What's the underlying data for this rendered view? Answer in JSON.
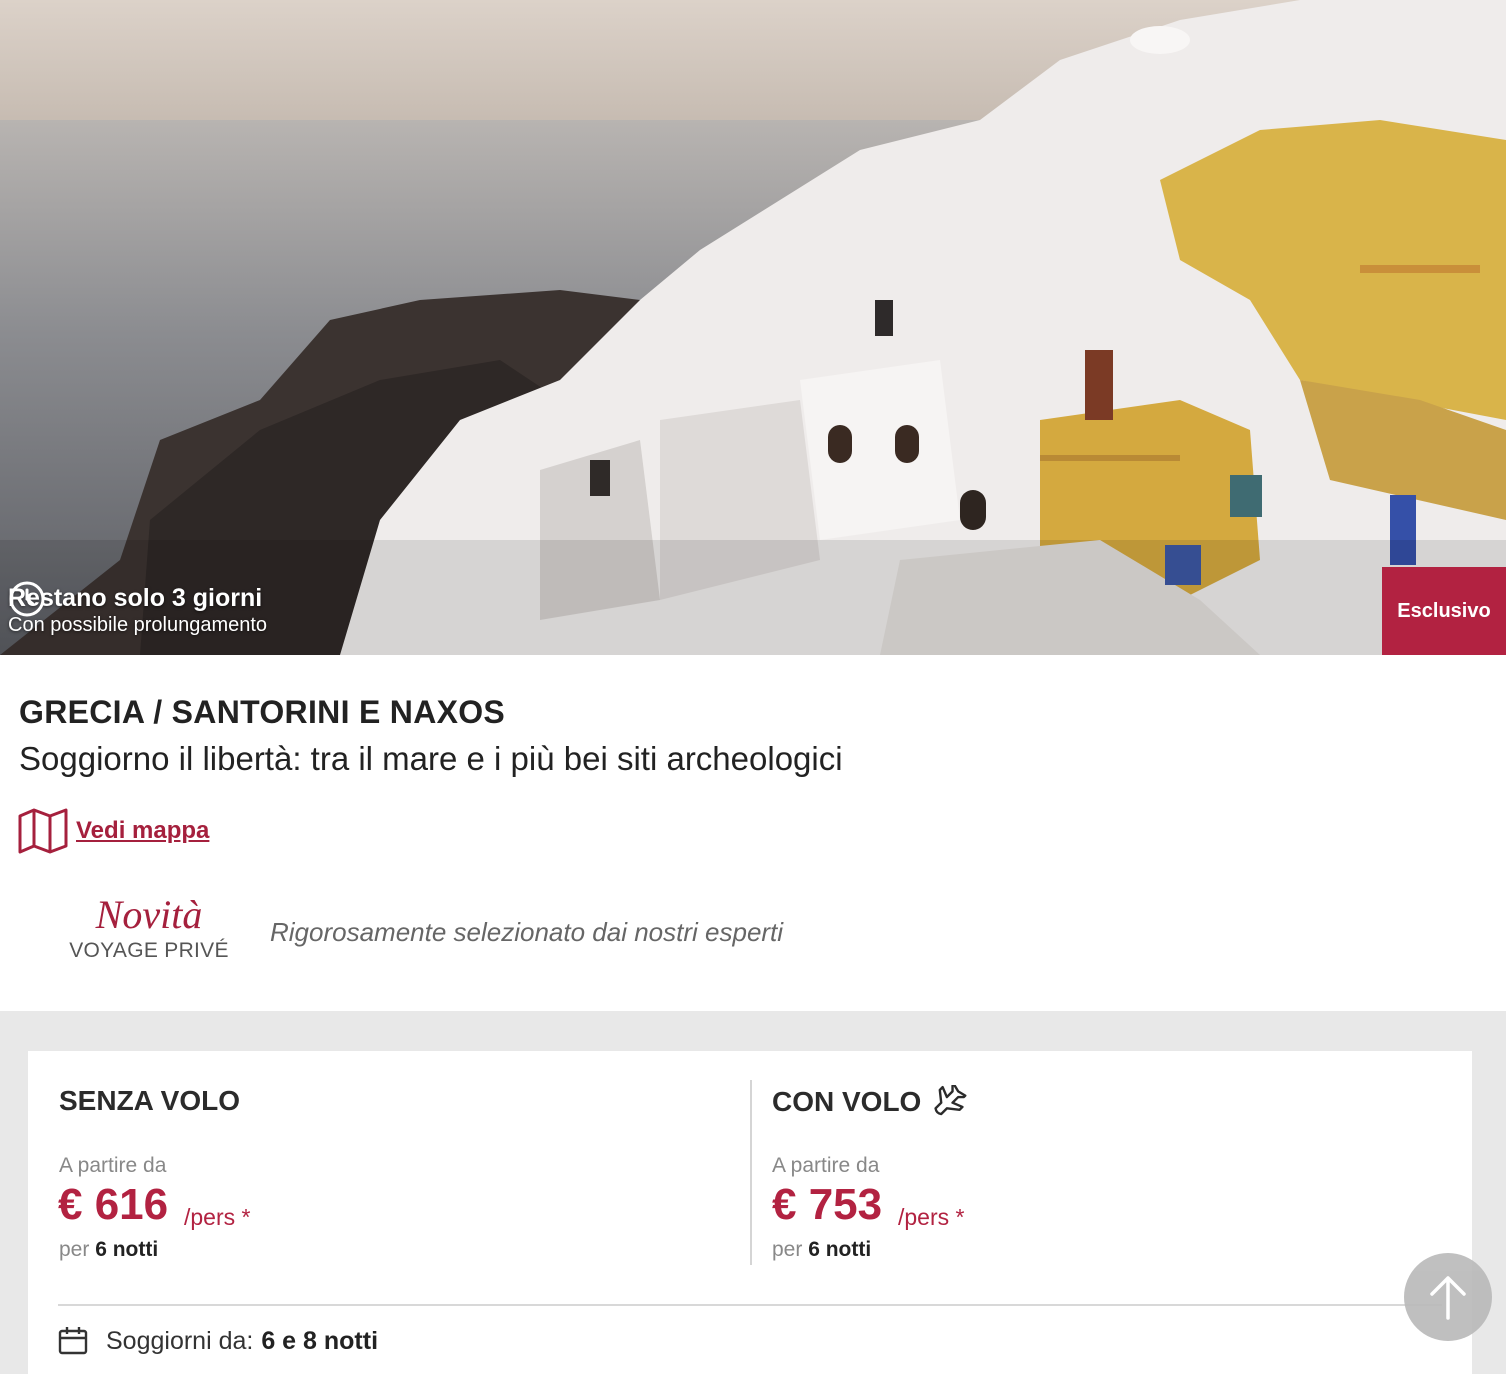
{
  "hero": {
    "deadline_title": "Restano solo 3 giorni",
    "deadline_subtitle": "Con possibile prolungamento",
    "badge": "Esclusivo",
    "clock_icon": "clock-icon"
  },
  "offer": {
    "destination": "GRECIA / SANTORINI E NAXOS",
    "subtitle": "Soggiorno il libertà: tra il mare e i più bei siti archeologici",
    "map_link": "Vedi mappa",
    "map_icon": "map-icon"
  },
  "badge_block": {
    "novita": "Novità",
    "brand": "VOYAGE PRIVÉ",
    "tagline": "Rigorosamente selezionato dai nostri esperti"
  },
  "pricing": {
    "without_flight": {
      "title": "SENZA VOLO",
      "from_label": "A partire da",
      "price": "€ 616",
      "per_person": "/pers *",
      "nights_prefix": "per",
      "nights": "6 notti"
    },
    "with_flight": {
      "title": "CON VOLO",
      "plane_icon": "airplane-icon",
      "from_label": "A partire da",
      "price": "€ 753",
      "per_person": "/pers *",
      "nights_prefix": "per",
      "nights": "6 notti"
    },
    "stays_label": "Soggiorni da:",
    "stays_value": "6 e 8 notti",
    "calendar_icon": "calendar-icon"
  },
  "colors": {
    "accent": "#b22241",
    "link": "#a5203d",
    "page_gray": "#e8e8e8"
  },
  "scroll_top_icon": "arrow-up-icon"
}
